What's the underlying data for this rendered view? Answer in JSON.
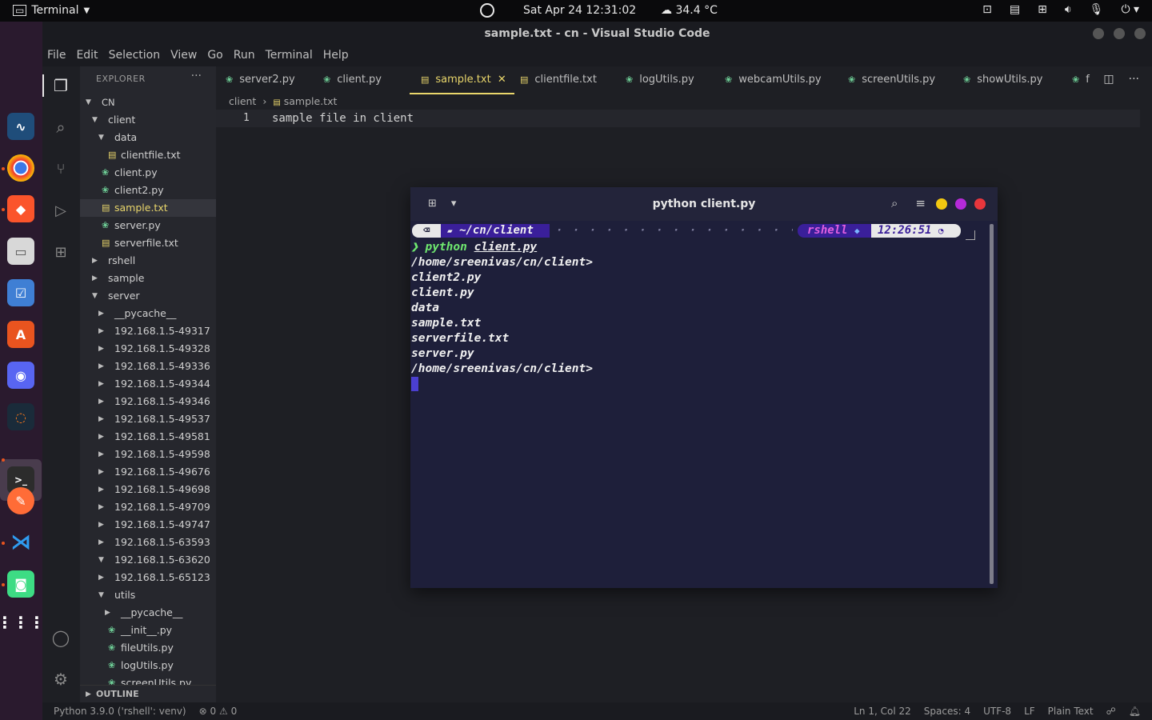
{
  "topbar": {
    "app_name": "Terminal",
    "datetime": "Sat Apr 24  12:31:02",
    "temperature": "34.4 °C"
  },
  "vscode": {
    "window_title": "sample.txt - cn - Visual Studio Code",
    "menu": [
      "File",
      "Edit",
      "Selection",
      "View",
      "Go",
      "Run",
      "Terminal",
      "Help"
    ],
    "explorer_title": "EXPLORER",
    "tree": [
      {
        "label": "CN",
        "depth": 0,
        "type": "folder-open"
      },
      {
        "label": "client",
        "depth": 1,
        "type": "folder-open"
      },
      {
        "label": "data",
        "depth": 2,
        "type": "folder-open"
      },
      {
        "label": "clientfile.txt",
        "depth": 3,
        "type": "txt"
      },
      {
        "label": "client.py",
        "depth": 2,
        "type": "py"
      },
      {
        "label": "client2.py",
        "depth": 2,
        "type": "py"
      },
      {
        "label": "sample.txt",
        "depth": 2,
        "type": "txt",
        "selected": true
      },
      {
        "label": "server.py",
        "depth": 2,
        "type": "py"
      },
      {
        "label": "serverfile.txt",
        "depth": 2,
        "type": "txt"
      },
      {
        "label": "rshell",
        "depth": 1,
        "type": "folder"
      },
      {
        "label": "sample",
        "depth": 1,
        "type": "folder"
      },
      {
        "label": "server",
        "depth": 1,
        "type": "folder-open"
      },
      {
        "label": "__pycache__",
        "depth": 2,
        "type": "folder"
      },
      {
        "label": "192.168.1.5-49317",
        "depth": 2,
        "type": "folder"
      },
      {
        "label": "192.168.1.5-49328",
        "depth": 2,
        "type": "folder"
      },
      {
        "label": "192.168.1.5-49336",
        "depth": 2,
        "type": "folder"
      },
      {
        "label": "192.168.1.5-49344",
        "depth": 2,
        "type": "folder"
      },
      {
        "label": "192.168.1.5-49346",
        "depth": 2,
        "type": "folder"
      },
      {
        "label": "192.168.1.5-49537",
        "depth": 2,
        "type": "folder"
      },
      {
        "label": "192.168.1.5-49581",
        "depth": 2,
        "type": "folder"
      },
      {
        "label": "192.168.1.5-49598",
        "depth": 2,
        "type": "folder"
      },
      {
        "label": "192.168.1.5-49676",
        "depth": 2,
        "type": "folder"
      },
      {
        "label": "192.168.1.5-49698",
        "depth": 2,
        "type": "folder"
      },
      {
        "label": "192.168.1.5-49709",
        "depth": 2,
        "type": "folder"
      },
      {
        "label": "192.168.1.5-49747",
        "depth": 2,
        "type": "folder"
      },
      {
        "label": "192.168.1.5-63593",
        "depth": 2,
        "type": "folder"
      },
      {
        "label": "192.168.1.5-63620",
        "depth": 2,
        "type": "folder-open"
      },
      {
        "label": "192.168.1.5-65123",
        "depth": 2,
        "type": "folder"
      },
      {
        "label": "utils",
        "depth": 2,
        "type": "folder-open"
      },
      {
        "label": "__pycache__",
        "depth": 3,
        "type": "folder"
      },
      {
        "label": "__init__.py",
        "depth": 3,
        "type": "py"
      },
      {
        "label": "fileUtils.py",
        "depth": 3,
        "type": "py"
      },
      {
        "label": "logUtils.py",
        "depth": 3,
        "type": "py"
      },
      {
        "label": "screenUtils.py",
        "depth": 3,
        "type": "py"
      }
    ],
    "outline_label": "OUTLINE",
    "tabs": [
      {
        "label": "server2.py",
        "type": "py"
      },
      {
        "label": "client.py",
        "type": "py"
      },
      {
        "label": "sample.txt",
        "type": "txt",
        "active": true
      },
      {
        "label": "clientfile.txt",
        "type": "txt"
      },
      {
        "label": "logUtils.py",
        "type": "py"
      },
      {
        "label": "webcamUtils.py",
        "type": "py"
      },
      {
        "label": "screenUtils.py",
        "type": "py"
      },
      {
        "label": "showUtils.py",
        "type": "py"
      },
      {
        "label": "f",
        "type": "py"
      }
    ],
    "breadcrumb": {
      "folder": "client",
      "file": "sample.txt"
    },
    "editor": {
      "line_number": "1",
      "content": "sample file in client"
    },
    "status": {
      "interpreter": "Python 3.9.0 ('rshell': venv)",
      "errors": "0",
      "warnings": "0",
      "position": "Ln 1, Col 22",
      "spaces": "Spaces: 4",
      "encoding": "UTF-8",
      "eol": "LF",
      "language": "Plain Text"
    }
  },
  "terminal": {
    "title": "python client.py",
    "prompt": {
      "path": "~/cn/client",
      "env": "rshell",
      "time": "12:26:51"
    },
    "command": {
      "prefix": "python",
      "arg": "client.py"
    },
    "output": [
      "/home/sreenivas/cn/client>",
      "client2.py",
      "client.py",
      "data",
      "sample.txt",
      "serverfile.txt",
      "server.py",
      "/home/sreenivas/cn/client>"
    ]
  },
  "colors": {
    "accent_yellow": "#e9d66b",
    "py_green": "#6fcf97",
    "prompt_purple": "#4b1fa0",
    "prompt_pink": "#c83fc8",
    "terminal_bg": "#1e1f3a"
  }
}
